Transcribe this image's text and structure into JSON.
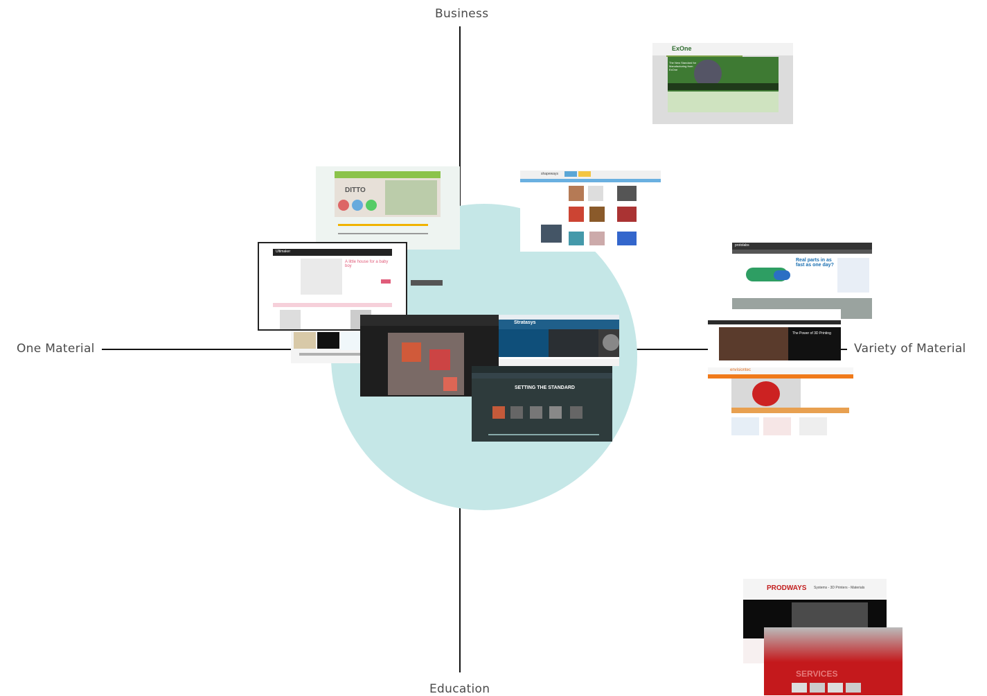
{
  "axes": {
    "top": "Business",
    "bottom": "Education",
    "left": "One Material",
    "right": "Variety of Material"
  },
  "thumbnails": {
    "exone": {
      "brand": "ExOne",
      "headline": "The New Standard for Manufacturing from ExOne"
    },
    "cubeworks": {
      "brand": "DITTO"
    },
    "shapeways": {
      "brand": "shapeways"
    },
    "ultimaker": {
      "brand": "Ultimaker",
      "headline": "A little house for a baby boy"
    },
    "protolabs": {
      "brand": "protolabs",
      "headline": "Real parts in as fast as one day?"
    },
    "stratasys": {
      "brand": "Stratasys"
    },
    "makerbot": {
      "heading": "SETTING THE STANDARD"
    },
    "cubify": {
      "heading": "The Power of 3D Printing"
    },
    "envisiontec": {
      "brand": "envisiontec"
    },
    "prodways": {
      "brand": "PRODWAYS",
      "tagline": "Systems - 3D Printers - Materials",
      "section": "SERVICES"
    }
  },
  "colors": {
    "circle": "#c5e7e7",
    "axis": "#111111",
    "label": "#4a4a4a"
  }
}
